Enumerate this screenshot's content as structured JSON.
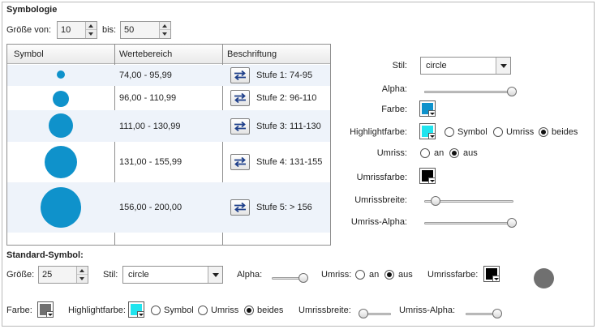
{
  "symbology": {
    "title": "Symbologie",
    "size_from_label": "Größe von:",
    "size_from_value": "10",
    "size_to_label": "bis:",
    "size_to_value": "50"
  },
  "table": {
    "headers": [
      "Symbol",
      "Wertebereich",
      "Beschriftung"
    ],
    "rows": [
      {
        "range": "74,00 - 95,99",
        "caption": "Stufe 1: 74-95"
      },
      {
        "range": "96,00 - 110,99",
        "caption": "Stufe 2: 96-110"
      },
      {
        "range": "111,00 - 130,99",
        "caption": "Stufe 3: 111-130"
      },
      {
        "range": "131,00 - 155,99",
        "caption": "Stufe 4: 131-155"
      },
      {
        "range": "156,00 - 200,00",
        "caption": "Stufe 5: > 156"
      }
    ],
    "symbol_color": "#0f92cb"
  },
  "right_panel": {
    "style_label": "Stil:",
    "style_value": "circle",
    "alpha_label": "Alpha:",
    "alpha_value": 1.0,
    "color_label": "Farbe:",
    "color_value": "#0f92cb",
    "highlight_label": "Highlightfarbe:",
    "highlight_value": "#20e4ee",
    "highlight_options": [
      "Symbol",
      "Umriss",
      "beides"
    ],
    "highlight_selected": "beides",
    "outline_label": "Umriss:",
    "outline_options": [
      "an",
      "aus"
    ],
    "outline_selected": "aus",
    "outline_color_label": "Umrissfarbe:",
    "outline_color_value": "#000000",
    "outline_width_label": "Umrissbreite:",
    "outline_width_value": 0.1,
    "outline_alpha_label": "Umriss-Alpha:",
    "outline_alpha_value": 1.0
  },
  "standard": {
    "title": "Standard-Symbol:",
    "size_label": "Größe:",
    "size_value": "25",
    "style_label": "Stil:",
    "style_value": "circle",
    "alpha_label": "Alpha:",
    "alpha_value": 1.0,
    "outline_label": "Umriss:",
    "outline_options": [
      "an",
      "aus"
    ],
    "outline_selected": "aus",
    "outline_color_label": "Umrissfarbe:",
    "outline_color_value": "#000000",
    "preview_color": "#707070",
    "color_label": "Farbe:",
    "color_value": "#707070",
    "highlight_label": "Highlightfarbe:",
    "highlight_value": "#20e4ee",
    "highlight_options": [
      "Symbol",
      "Umriss",
      "beides"
    ],
    "highlight_selected": "beides",
    "outline_width_label": "Umrissbreite:",
    "outline_width_value": 0.1,
    "outline_alpha_label": "Umriss-Alpha:",
    "outline_alpha_value": 1.0
  }
}
